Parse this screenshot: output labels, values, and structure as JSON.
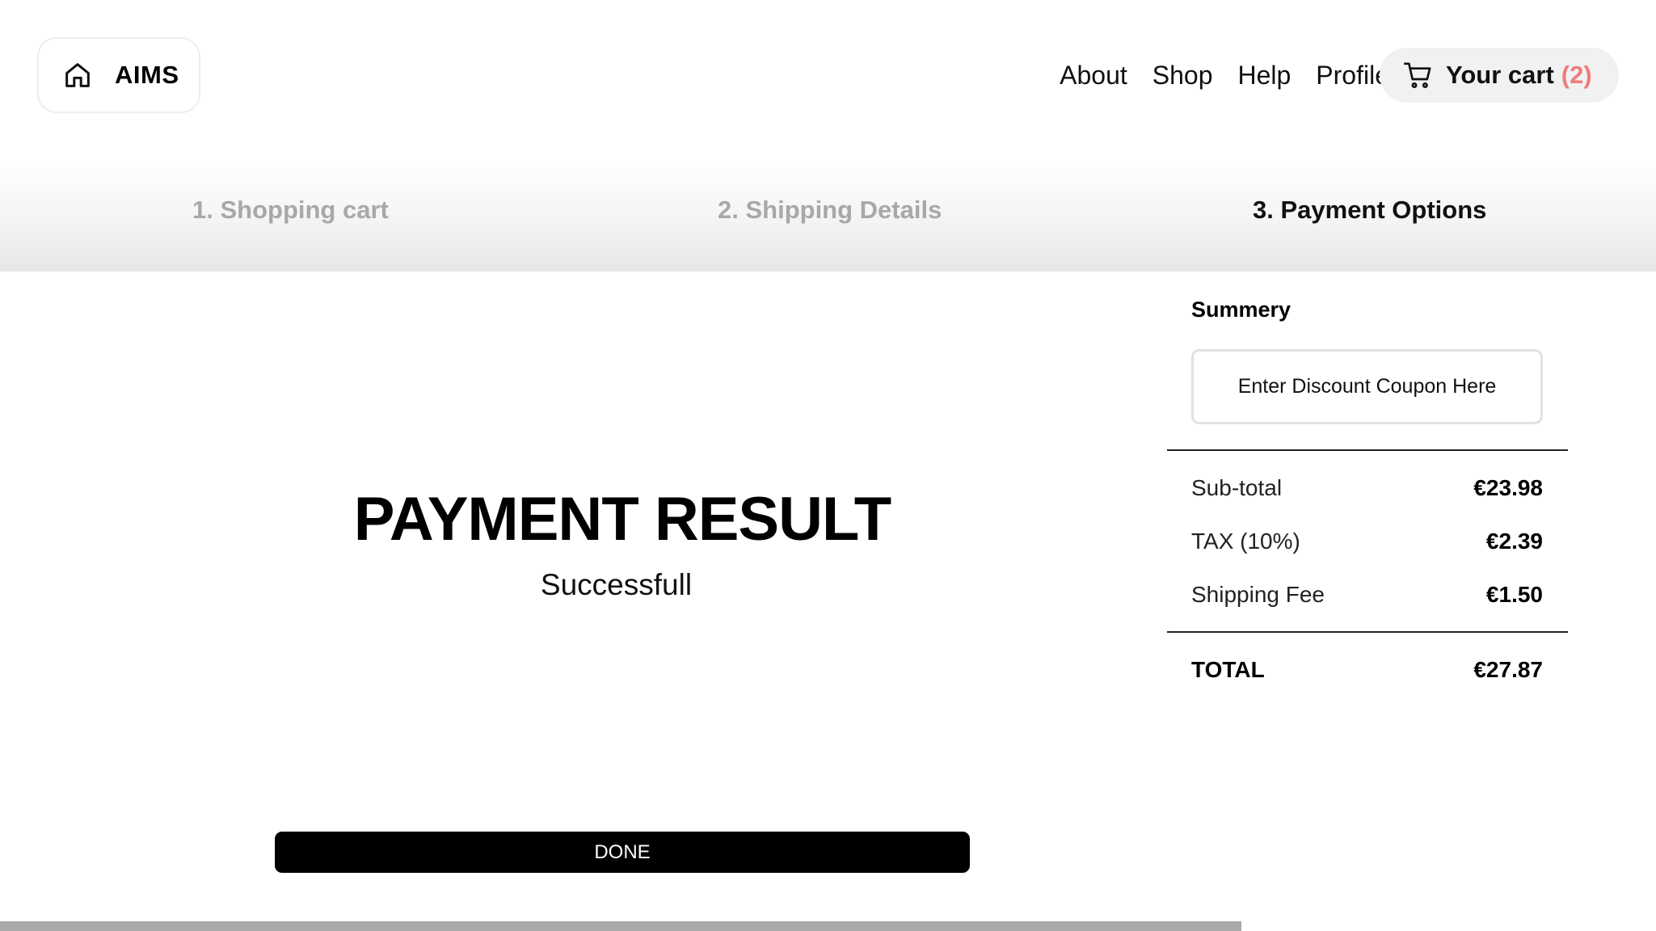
{
  "header": {
    "brand": "AIMS",
    "nav": [
      "About",
      "Shop",
      "Help",
      "Profile"
    ],
    "cart": {
      "label": "Your cart",
      "count": "(2)"
    },
    "colors": {
      "cart_count": "#f07b7b",
      "cart_bg": "#f1f1f1"
    }
  },
  "steps": [
    {
      "label": "1. Shopping cart",
      "active": false
    },
    {
      "label": "2. Shipping Details",
      "active": false
    },
    {
      "label": "3. Payment Options",
      "active": true
    }
  ],
  "result": {
    "title": "PAYMENT RESULT",
    "status": "Successfull",
    "done_label": "DONE"
  },
  "summary": {
    "title": "Summery",
    "coupon_placeholder": "Enter Discount Coupon Here",
    "rows": [
      {
        "label": "Sub-total",
        "value": "€23.98"
      },
      {
        "label": "TAX (10%)",
        "value": "€2.39"
      },
      {
        "label": "Shipping Fee",
        "value": "€1.50"
      }
    ],
    "total": {
      "label": "TOTAL",
      "value": "€27.87"
    }
  },
  "icons": {
    "home": "home-icon",
    "cart": "cart-icon"
  }
}
